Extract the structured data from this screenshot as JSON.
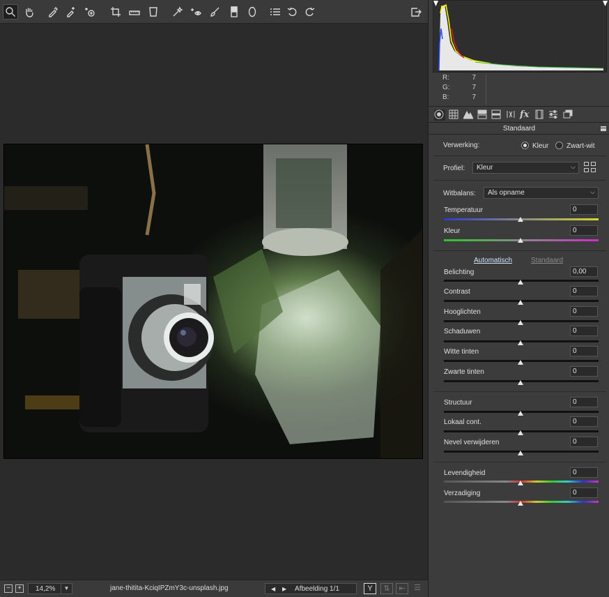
{
  "toolbar": {
    "tools": [
      {
        "icon": "zoom-icon",
        "active": true
      },
      {
        "icon": "hand-icon"
      },
      {
        "icon": "white-balance-eyedropper-icon"
      },
      {
        "icon": "color-sampler-icon"
      },
      {
        "icon": "targeted-adjustment-icon"
      },
      {
        "icon": "crop-icon"
      },
      {
        "icon": "straighten-icon"
      },
      {
        "icon": "transform-icon"
      },
      {
        "icon": "spot-removal-icon"
      },
      {
        "icon": "red-eye-icon"
      },
      {
        "icon": "adjustment-brush-icon"
      },
      {
        "icon": "graduated-filter-icon"
      },
      {
        "icon": "radial-filter-icon"
      },
      {
        "icon": "preferences-list-icon"
      },
      {
        "icon": "rotate-left-icon"
      },
      {
        "icon": "rotate-right-icon"
      }
    ],
    "export_icon": "open-image-icon"
  },
  "bottombar": {
    "zoom_out": "−",
    "zoom_in": "+",
    "zoom": "14,2%",
    "filename": "jane-thitita-KciqIPZmY3c-unsplash.jpg",
    "image_counter": "Afbeelding 1/1",
    "flag_label": "Y"
  },
  "histogram": {
    "r_label": "R:",
    "r": "7",
    "g_label": "G:",
    "g": "7",
    "b_label": "B:",
    "b": "7"
  },
  "panel": {
    "title": "Standaard",
    "verwerking_label": "Verwerking:",
    "kleur_option": "Kleur",
    "zwartwit_option": "Zwart-wit",
    "profiel_label": "Profiel:",
    "profiel_value": "Kleur",
    "witbalans_label": "Witbalans:",
    "witbalans_value": "Als opname",
    "automatisch": "Automatisch",
    "standaard_link": "Standaard"
  },
  "sliders": {
    "temperatuur": {
      "label": "Temperatuur",
      "value": "0"
    },
    "kleur": {
      "label": "Kleur",
      "value": "0"
    },
    "belichting": {
      "label": "Belichting",
      "value": "0,00"
    },
    "contrast": {
      "label": "Contrast",
      "value": "0"
    },
    "hooglichten": {
      "label": "Hooglichten",
      "value": "0"
    },
    "schaduwen": {
      "label": "Schaduwen",
      "value": "0"
    },
    "witte_tinten": {
      "label": "Witte tinten",
      "value": "0"
    },
    "zwarte_tinten": {
      "label": "Zwarte tinten",
      "value": "0"
    },
    "structuur": {
      "label": "Structuur",
      "value": "0"
    },
    "lokaal_cont": {
      "label": "Lokaal cont.",
      "value": "0"
    },
    "nevel": {
      "label": "Nevel verwijderen",
      "value": "0"
    },
    "levendigheid": {
      "label": "Levendigheid",
      "value": "0"
    },
    "verzadiging": {
      "label": "Verzadiging",
      "value": "0"
    }
  },
  "colors": {
    "accent_link": "#cfe3ff",
    "disabled_link": "#8a8a8a"
  }
}
